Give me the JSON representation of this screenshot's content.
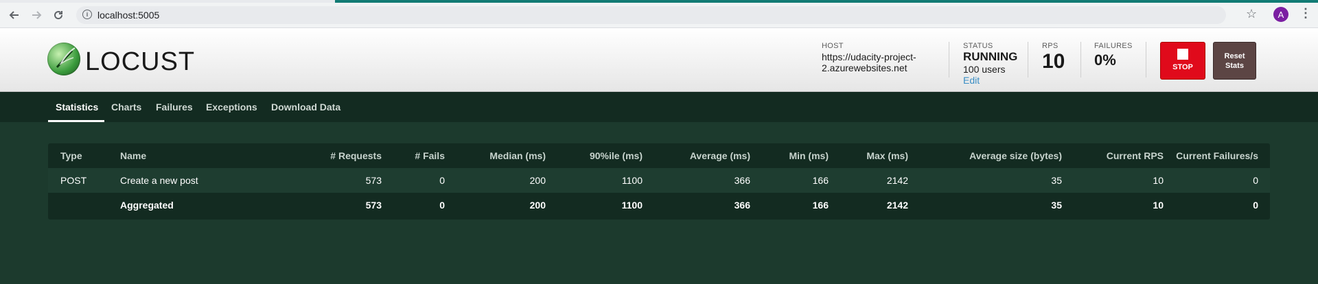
{
  "browser": {
    "url": "localhost:5005",
    "avatar_letter": "A"
  },
  "header": {
    "logo_text": "LOCUST",
    "host_label": "HOST",
    "host_value_line1": "https://udacity-project-",
    "host_value_line2": "2.azurewebsites.net",
    "status_label": "STATUS",
    "status_value": "RUNNING",
    "users_value": "100 users",
    "edit_label": "Edit",
    "rps_label": "RPS",
    "rps_value": "10",
    "failures_label": "FAILURES",
    "failures_value": "0%",
    "stop_label": "STOP",
    "reset_label_line1": "Reset",
    "reset_label_line2": "Stats"
  },
  "tabs": [
    {
      "label": "Statistics",
      "active": true
    },
    {
      "label": "Charts"
    },
    {
      "label": "Failures"
    },
    {
      "label": "Exceptions"
    },
    {
      "label": "Download Data"
    }
  ],
  "table": {
    "columns": [
      "Type",
      "Name",
      "# Requests",
      "# Fails",
      "Median (ms)",
      "90%ile (ms)",
      "Average (ms)",
      "Min (ms)",
      "Max (ms)",
      "Average size (bytes)",
      "Current RPS",
      "Current Failures/s"
    ],
    "rows": [
      [
        "POST",
        "Create a new post",
        "573",
        "0",
        "200",
        "1100",
        "366",
        "166",
        "2142",
        "35",
        "10",
        "0"
      ],
      [
        "",
        "Aggregated",
        "573",
        "0",
        "200",
        "1100",
        "366",
        "166",
        "2142",
        "35",
        "10",
        "0"
      ]
    ]
  },
  "colors": {
    "page_bg": "#1c3a2d",
    "stop_button": "#e00a1b",
    "reset_button": "#5c4544",
    "tab_bar": "#132b21",
    "edit_link": "#3a8ec4"
  }
}
